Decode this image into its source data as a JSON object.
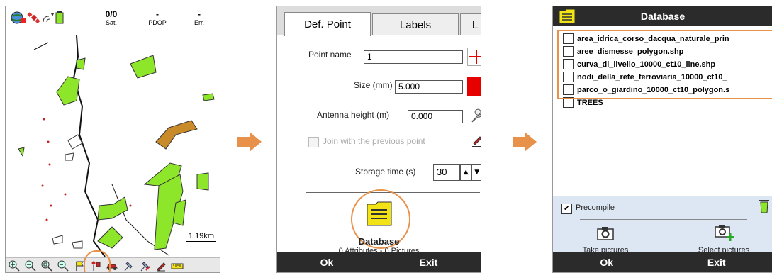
{
  "panel1": {
    "status": {
      "sat_value": "0/0",
      "sat_label": "Sat.",
      "pdop_value": "-",
      "pdop_label": "PDOP",
      "err_value": "-",
      "err_label": "Err."
    },
    "scale": "1.19km",
    "status_icons": [
      "globe-icon",
      "satellite-icon",
      "signal-icon",
      "battery-icon"
    ],
    "toolbar_icons": [
      "zoom-in-icon",
      "zoom-out-icon",
      "zoom-window-icon",
      "zoom-extent-icon",
      "flag-icon",
      "survey-point-icon",
      "car-icon",
      "pin-icon",
      "pin-edit-icon",
      "pencil-icon",
      "ruler-icon"
    ]
  },
  "panel2": {
    "tabs": [
      "Def. Point",
      "Labels",
      "L"
    ],
    "point_name_label": "Point name",
    "point_name_value": "1",
    "size_label": "Size (mm)",
    "size_value": "5.000",
    "antenna_label": "Antenna height (m)",
    "antenna_value": "0.000",
    "join_label": "Join with the previous point",
    "storage_label": "Storage time (s)",
    "storage_value": "30",
    "database_label": "Database",
    "attributes_text": "0 Attributes - 0 Pictures",
    "ok": "Ok",
    "exit": "Exit",
    "symbol_color": "#e60000"
  },
  "panel3": {
    "title": "Database",
    "layers": [
      "area_idrica_corso_dacqua_naturale_prin",
      "aree_dismesse_polygon.shp",
      "curva_di_livello_10000_ct10_line.shp",
      "nodi_della_rete_ferroviaria_10000_ct10_",
      "parco_o_giardino_10000_ct10_polygon.s",
      "TREES"
    ],
    "precompile": "Precompile",
    "take_pictures": "Take pictures",
    "select_pictures": "Select pictures",
    "ok": "Ok",
    "exit": "Exit"
  },
  "colors": {
    "highlight": "#e8914a",
    "arrow": "#e8914a",
    "map_green": "#8ee62a",
    "map_brown": "#c98a2a",
    "database_yellow": "#f2e317"
  }
}
